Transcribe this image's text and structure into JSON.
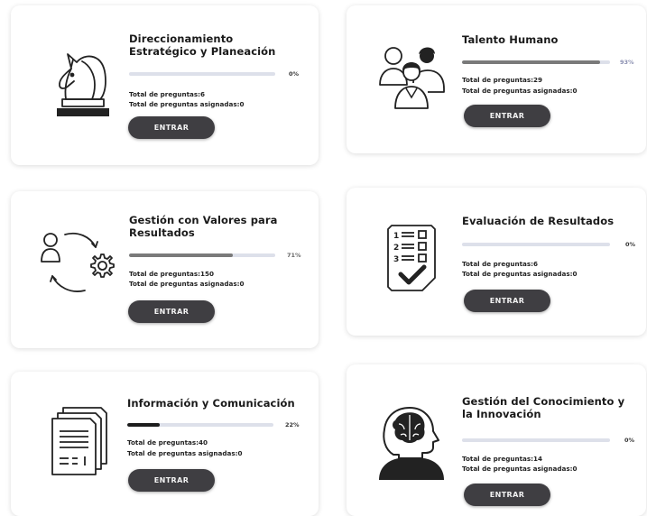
{
  "cards": [
    {
      "title": "Direccionamiento Estratégico y Planeación",
      "progress": 0,
      "progress_label": "0%",
      "total_label": "Total de preguntas:",
      "total": "6",
      "assigned_label": "Total de preguntas asignadas:",
      "assigned": "0",
      "button": "ENTRAR",
      "icon": "chess-knight-icon"
    },
    {
      "title": "Talento Humano",
      "progress": 0.93,
      "progress_label": "93%",
      "total_label": "Total de preguntas:",
      "total": "29",
      "assigned_label": "Total de preguntas asignadas:",
      "assigned": "0",
      "button": "ENTRAR",
      "icon": "people-group-icon"
    },
    {
      "title": "Gestión con Valores para Resultados",
      "progress": 0.71,
      "progress_label": "71%",
      "total_label": "Total de preguntas:",
      "total": "150",
      "assigned_label": "Total de preguntas asignadas:",
      "assigned": "0",
      "button": "ENTRAR",
      "icon": "person-gear-cycle-icon"
    },
    {
      "title": "Evaluación de Resultados",
      "progress": 0,
      "progress_label": "0%",
      "total_label": "Total de preguntas:",
      "total": "6",
      "assigned_label": "Total de preguntas asignadas:",
      "assigned": "0",
      "button": "ENTRAR",
      "icon": "checklist-icon"
    },
    {
      "title": "Información y Comunicación",
      "progress": 0.22,
      "progress_label": "22%",
      "total_label": "Total de preguntas:",
      "total": "40",
      "assigned_label": "Total de preguntas asignadas:",
      "assigned": "0",
      "button": "ENTRAR",
      "icon": "documents-stack-icon"
    },
    {
      "title": "Gestión del Conocimiento y la Innovación",
      "progress": 0,
      "progress_label": "0%",
      "total_label": "Total de preguntas:",
      "total": "14",
      "assigned_label": "Total de preguntas asignadas:",
      "assigned": "0",
      "button": "ENTRAR",
      "icon": "head-brain-icon"
    }
  ],
  "colors": {
    "button": "#3f3e42",
    "bar_track": "#dde0ea",
    "bar_fill": "#7a7a7a",
    "bar_fill_dark": "#1d1d1d"
  }
}
